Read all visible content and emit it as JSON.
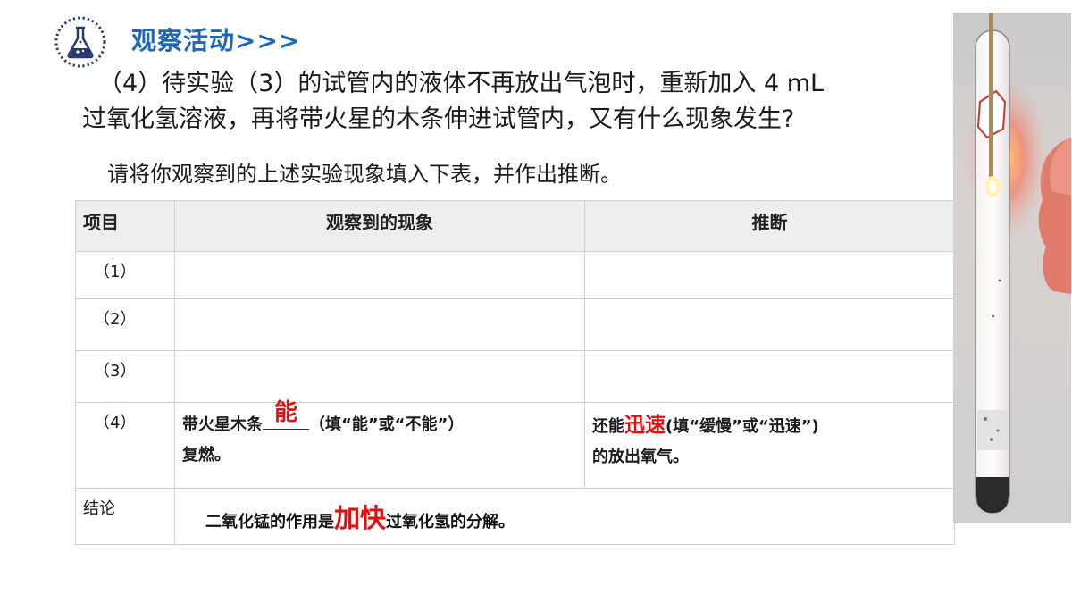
{
  "header": {
    "title": "观察活动>>>"
  },
  "question": {
    "line1": "（4）待实验（3）的试管内的液体不再放出气泡时，重新加入 4 mL",
    "line2": "过氧化氢溶液，再将带火星的木条伸进试管内，又有什么现象发生?"
  },
  "instruction": "请将你观察到的上述实验现象填入下表，并作出推断。",
  "table": {
    "headers": [
      "项目",
      "观察到的现象",
      "推断"
    ],
    "rows": [
      {
        "index": "（1）"
      },
      {
        "index": "（2）"
      },
      {
        "index": "（3）"
      },
      {
        "index": "（4）",
        "phenomenon": {
          "prefix": "带火星木条",
          "answer": "能",
          "hint": "（填“能”或“不能”）",
          "suffix": "复燃。"
        },
        "inference": {
          "prefix": "还能",
          "answer": "迅速",
          "hint": "(填“缓慢”或“迅速”)",
          "suffix": "的放出氧气。"
        }
      }
    ],
    "conclusion": {
      "label": "结论",
      "prefix": "二氧化锰的作用是",
      "answer": "加快",
      "suffix": "过氧化氢的分解。"
    }
  },
  "colors": {
    "title": "#1e66b8",
    "answer": "#e01010",
    "header_bg": "#eeeeee"
  },
  "icons": {
    "logo": "flask-icon",
    "photo": "test-tube-photo"
  }
}
